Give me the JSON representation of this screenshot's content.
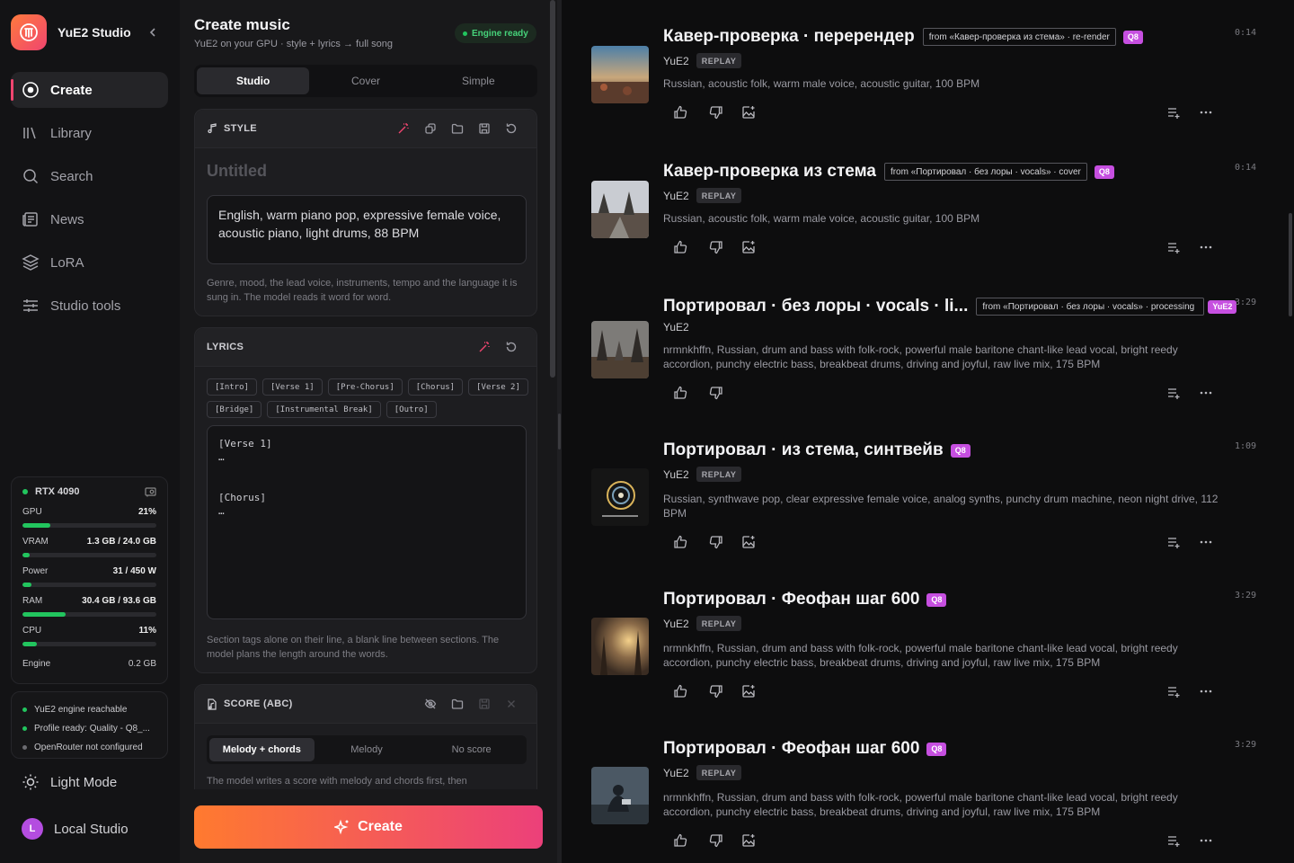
{
  "sidebar": {
    "brand": "YuE2 Studio",
    "nav": [
      {
        "label": "Create",
        "icon": "create-icon",
        "active": true
      },
      {
        "label": "Library",
        "icon": "library-icon"
      },
      {
        "label": "Search",
        "icon": "search-icon"
      },
      {
        "label": "News",
        "icon": "news-icon"
      },
      {
        "label": "LoRA",
        "icon": "layers-icon"
      },
      {
        "label": "Studio tools",
        "icon": "sliders-icon"
      }
    ],
    "hardware": {
      "name": "RTX 4090",
      "metrics": [
        {
          "label": "GPU",
          "value": "21%",
          "fraction": 0.21
        },
        {
          "label": "VRAM",
          "value": "1.3 GB / 24.0 GB",
          "fraction": 0.054
        },
        {
          "label": "Power",
          "value": "31 / 450 W",
          "fraction": 0.069
        },
        {
          "label": "RAM",
          "value": "30.4 GB / 93.6 GB",
          "fraction": 0.325
        },
        {
          "label": "CPU",
          "value": "11%",
          "fraction": 0.11
        }
      ],
      "engine_label": "Engine",
      "engine_value": "0.2 GB"
    },
    "status": [
      {
        "text": "YuE2 engine reachable",
        "ok": true
      },
      {
        "text": "Profile ready: Quality - Q8_...",
        "ok": true
      },
      {
        "text": "OpenRouter not configured",
        "ok": false
      }
    ],
    "light_mode": "Light Mode",
    "account_initial": "L",
    "account_name": "Local Studio"
  },
  "panel": {
    "title": "Create music",
    "subtitle": "YuE2 on your GPU · style + lyrics → full song",
    "engine_badge": "Engine ready",
    "tabs": [
      "Studio",
      "Cover",
      "Simple"
    ],
    "style": {
      "header": "STYLE",
      "title_placeholder": "Untitled",
      "text": "English, warm piano pop, expressive female voice, acoustic piano, light drums, 88 BPM",
      "hint": "Genre, mood, the lead voice, instruments, tempo and the language it is sung in. The model reads it word for word."
    },
    "lyrics": {
      "header": "LYRICS",
      "tags_row1": [
        "[Intro]",
        "[Verse 1]",
        "[Pre-Chorus]",
        "[Chorus]",
        "[Verse 2]"
      ],
      "tags_row2": [
        "[Bridge]",
        "[Instrumental Break]",
        "[Outro]"
      ],
      "text": "[Verse 1]\n…\n\n\n[Chorus]\n…",
      "hint": "Section tags alone on their line, a blank line between sections. The model plans the length around the words."
    },
    "score": {
      "header": "SCORE (ABC)",
      "options": [
        "Melody + chords",
        "Melody",
        "No score"
      ],
      "hint": "The model writes a score with melody and chords first, then"
    },
    "create_label": "Create"
  },
  "songs": [
    {
      "title": "Кавер-проверка · перерендер",
      "from": "from «Кавер-проверка из стема» · re-render",
      "badge": "Q8",
      "duration": "0:14",
      "model": "YuE2",
      "replay": "REPLAY",
      "desc": "Russian, acoustic folk, warm male voice, acoustic guitar, 100 BPM",
      "cover_art": true
    },
    {
      "title": "Кавер-проверка из стема",
      "from": "from «Портировал · без лоры · vocals» · cover",
      "badge": "Q8",
      "duration": "0:14",
      "model": "YuE2",
      "replay": "REPLAY",
      "desc": "Russian, acoustic folk, warm male voice, acoustic guitar, 100 BPM",
      "cover_art": true
    },
    {
      "title": "Портировал · без лоры · vocals · li...",
      "from": "from «Портировал · без лоры · vocals» · processing",
      "badge": "YuE2",
      "duration": "3:29",
      "model": "YuE2",
      "replay": "",
      "desc": "nrmnkhffn, Russian, drum and bass with folk-rock, powerful male baritone chant-like lead vocal, bright reedy accordion, punchy electric bass, breakbeat drums, driving and joyful, raw live mix, 175 BPM",
      "cover_art": false
    },
    {
      "title": "Портировал · из стема, синтвейв",
      "from": "",
      "badge": "Q8",
      "duration": "1:09",
      "model": "YuE2",
      "replay": "REPLAY",
      "desc": "Russian, synthwave pop, clear expressive female voice, analog synths, punchy drum machine, neon night drive, 112 BPM",
      "cover_art": true
    },
    {
      "title": "Портировал · Феофан шаг 600",
      "from": "",
      "badge": "Q8",
      "duration": "3:29",
      "model": "YuE2",
      "replay": "REPLAY",
      "desc": "nrmnkhffn, Russian, drum and bass with folk-rock, powerful male baritone chant-like lead vocal, bright reedy accordion, punchy electric bass, breakbeat drums, driving and joyful, raw live mix, 175 BPM",
      "cover_art": true
    },
    {
      "title": "Портировал · Феофан шаг 600",
      "from": "",
      "badge": "Q8",
      "duration": "3:29",
      "model": "YuE2",
      "replay": "REPLAY",
      "desc": "nrmnkhffn, Russian, drum and bass with folk-rock, powerful male baritone chant-like lead vocal, bright reedy accordion, punchy electric bass, breakbeat drums, driving and joyful, raw live mix, 175 BPM",
      "cover_art": true
    }
  ],
  "colors": {
    "accent": "#f0456f",
    "ok": "#22c55e",
    "badge": "#c64fe0",
    "create_from": "#ff7a2f",
    "create_to": "#ec407a"
  }
}
